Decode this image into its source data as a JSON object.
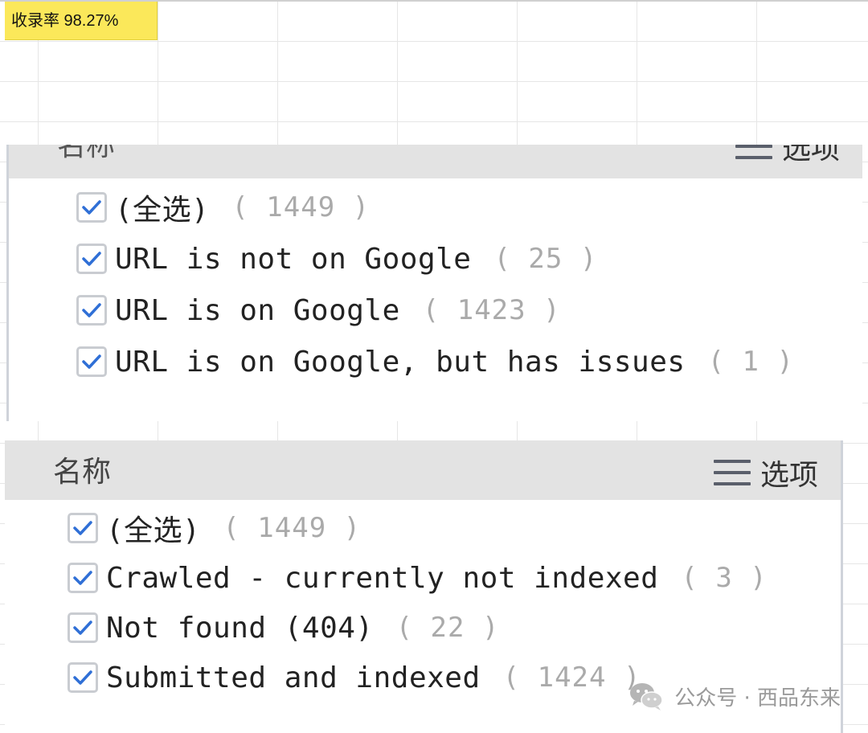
{
  "sheet": {
    "cell_a1": "收录率 98.27%",
    "cell_a1_color": "#fbe85a"
  },
  "panel1": {
    "header": {
      "name": "名称",
      "options": "选项"
    },
    "items": [
      {
        "label": "(全选)",
        "count": "( 1449 )",
        "checked": true
      },
      {
        "label": "URL is not on Google",
        "count": "( 25 )",
        "checked": true
      },
      {
        "label": "URL is on Google",
        "count": "( 1423 )",
        "checked": true
      },
      {
        "label": "URL is on Google, but has issues",
        "count": "( 1 )",
        "checked": true
      }
    ]
  },
  "panel2": {
    "header": {
      "name": "名称",
      "options": "选项"
    },
    "items": [
      {
        "label": "(全选)",
        "count": "( 1449 )",
        "checked": true
      },
      {
        "label": "Crawled - currently not indexed",
        "count": "( 3 )",
        "checked": true
      },
      {
        "label": "Not found (404)",
        "count": "( 22 )",
        "checked": true
      },
      {
        "label": "Submitted and indexed",
        "count": "( 1424 )",
        "checked": true
      }
    ]
  },
  "watermark": {
    "text": "公众号 · 西品东来",
    "icon": "wechat-icon"
  },
  "colors": {
    "checkmark": "#2f6fd6",
    "header_bg": "#e3e3e3",
    "count_text": "#aaaaaa"
  }
}
